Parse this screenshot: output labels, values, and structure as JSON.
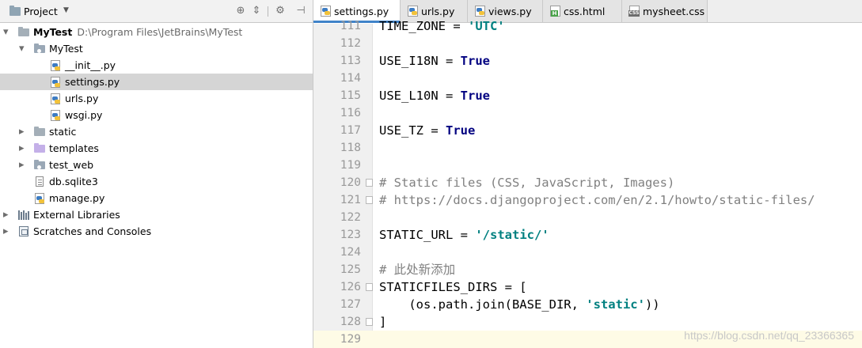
{
  "project_panel": {
    "title": "Project",
    "tree": [
      {
        "label": "MyTest",
        "path": "D:\\Program Files\\JetBrains\\MyTest",
        "kind": "folder-root",
        "expanded": true
      },
      {
        "label": "MyTest",
        "kind": "package",
        "expanded": true
      },
      {
        "label": "__init__.py",
        "kind": "python"
      },
      {
        "label": "settings.py",
        "kind": "python",
        "selected": true
      },
      {
        "label": "urls.py",
        "kind": "python"
      },
      {
        "label": "wsgi.py",
        "kind": "python"
      },
      {
        "label": "static",
        "kind": "folder",
        "expanded": false
      },
      {
        "label": "templates",
        "kind": "folder-templates",
        "expanded": false
      },
      {
        "label": "test_web",
        "kind": "package",
        "expanded": false
      },
      {
        "label": "db.sqlite3",
        "kind": "db"
      },
      {
        "label": "manage.py",
        "kind": "python"
      },
      {
        "label": "External Libraries",
        "kind": "libraries",
        "expanded": false
      },
      {
        "label": "Scratches and Consoles",
        "kind": "scratches",
        "expanded": false
      }
    ]
  },
  "editor": {
    "tabs": [
      {
        "label": "settings.py",
        "icon": "python-file-icon",
        "active": true
      },
      {
        "label": "urls.py",
        "icon": "python-file-icon"
      },
      {
        "label": "views.py",
        "icon": "python-file-icon"
      },
      {
        "label": "css.html",
        "icon": "html-file-icon"
      },
      {
        "label": "mysheet.css",
        "icon": "css-file-icon"
      }
    ],
    "lines": [
      {
        "n": "111",
        "text": "TIME_ZONE = 'UTC'"
      },
      {
        "n": "112",
        "text": ""
      },
      {
        "n": "113",
        "text": "USE_I18N = True"
      },
      {
        "n": "114",
        "text": ""
      },
      {
        "n": "115",
        "text": "USE_L10N = True"
      },
      {
        "n": "116",
        "text": ""
      },
      {
        "n": "117",
        "text": "USE_TZ = True"
      },
      {
        "n": "118",
        "text": ""
      },
      {
        "n": "119",
        "text": ""
      },
      {
        "n": "120",
        "text": "# Static files (CSS, JavaScript, Images)"
      },
      {
        "n": "121",
        "text": "# https://docs.djangoproject.com/en/2.1/howto/static-files/"
      },
      {
        "n": "122",
        "text": ""
      },
      {
        "n": "123",
        "text": "STATIC_URL = '/static/'"
      },
      {
        "n": "124",
        "text": ""
      },
      {
        "n": "125",
        "text": "# 此处新添加"
      },
      {
        "n": "126",
        "text": "STATICFILES_DIRS = ["
      },
      {
        "n": "127",
        "text": "    (os.path.join(BASE_DIR, 'static'))"
      },
      {
        "n": "128",
        "text": "]"
      },
      {
        "n": "129",
        "text": ""
      }
    ],
    "caret_line": "129"
  },
  "watermark": "https://blog.csdn.net/qq_23366365",
  "colors": {
    "keyword": "#000080",
    "string": "#008080",
    "comment": "#808080",
    "selection": "#d5d5d5",
    "active_tab_underline": "#4083c9"
  }
}
